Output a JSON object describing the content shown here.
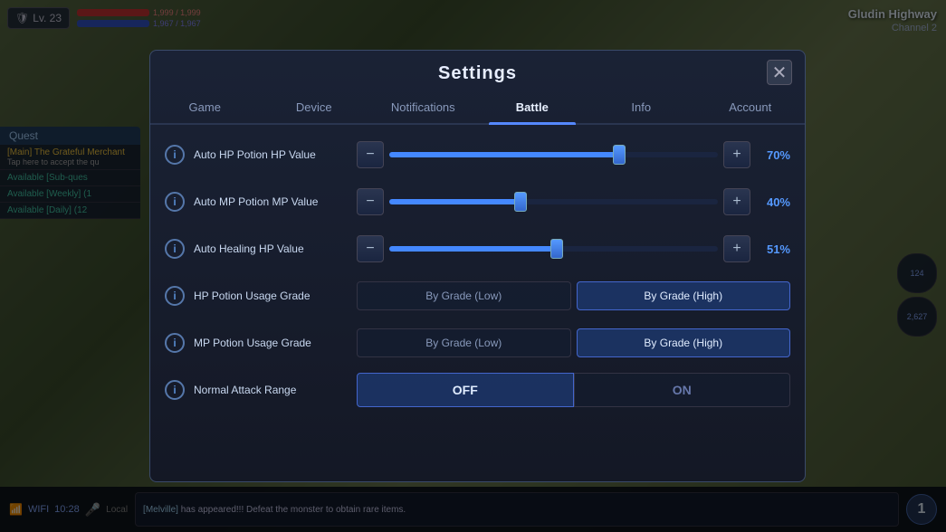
{
  "game": {
    "location": "Gludin Highway",
    "channel": "Channel 2",
    "player_level": "Lv. 23",
    "hp_current": "1,999",
    "hp_max": "1,999",
    "mp_current": "1,967",
    "mp_max": "1,967"
  },
  "hud": {
    "wifi_label": "WIFI",
    "time": "10:28",
    "resources": {
      "item1": "124",
      "item2": "2,627"
    },
    "counter": "1"
  },
  "quest_panel": {
    "header": "Quest",
    "main_quest": "[Main] The Grateful Merchant",
    "main_desc": "Tap here to accept the qu",
    "sub_quest1": "Available [Sub-ques",
    "sub_quest2": "Available [Weekly] (1",
    "sub_quest3": "Available [Daily] (12"
  },
  "chat": {
    "line1_name": "[Melville]",
    "line1_text": " has appeared!!! Defeat the monster to obtain rare items."
  },
  "modal": {
    "title": "Settings",
    "close_label": "✕",
    "tabs": [
      {
        "id": "game",
        "label": "Game",
        "active": false
      },
      {
        "id": "device",
        "label": "Device",
        "active": false
      },
      {
        "id": "notifications",
        "label": "Notifications",
        "active": false
      },
      {
        "id": "battle",
        "label": "Battle",
        "active": true
      },
      {
        "id": "info",
        "label": "Info",
        "active": false
      },
      {
        "id": "account",
        "label": "Account",
        "active": false
      }
    ],
    "settings": {
      "auto_hp_label": "Auto HP Potion HP Value",
      "auto_hp_value": "70%",
      "auto_hp_percent": 70,
      "auto_mp_label": "Auto MP Potion MP Value",
      "auto_mp_value": "40%",
      "auto_mp_percent": 40,
      "auto_heal_label": "Auto Healing HP Value",
      "auto_heal_value": "51%",
      "auto_heal_percent": 51,
      "hp_grade_label": "HP Potion Usage Grade",
      "hp_grade_low": "By Grade (Low)",
      "hp_grade_high": "By Grade (High)",
      "mp_grade_label": "MP Potion Usage Grade",
      "mp_grade_low": "By Grade (Low)",
      "mp_grade_high": "By Grade (High)",
      "attack_range_label": "Normal Attack Range",
      "attack_off": "OFF",
      "attack_on": "ON",
      "minus_label": "−",
      "plus_label": "+"
    }
  }
}
